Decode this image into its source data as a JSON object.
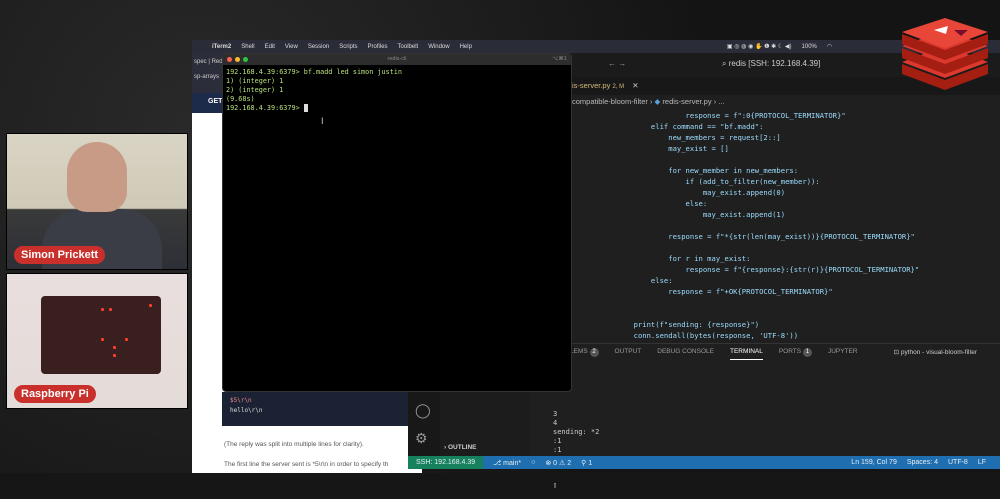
{
  "participants": [
    {
      "name": "Simon Prickett"
    },
    {
      "name": "Raspberry Pi"
    }
  ],
  "menubar": {
    "app": "iTerm2",
    "items": [
      "Shell",
      "Edit",
      "View",
      "Session",
      "Scripts",
      "Profiles",
      "Toolbelt",
      "Window",
      "Help"
    ],
    "battery": "100%"
  },
  "browser": {
    "tab": "spec | Redis",
    "tab2": "sp-arrays",
    "nav": "GET",
    "code_lines": [
      "$5\\r\\n",
      "hello\\r\\n"
    ],
    "para1": "(The reply was split into multiple lines for clarity).",
    "para2": "The first line the server sent is *5\\r\\n in order to specify th"
  },
  "iterm": {
    "title": "redis-cli",
    "shortcut": "⌥⌘1",
    "lines": [
      "192.168.4.39:6379> bf.madd led simon justin",
      "1) (integer) 1",
      "2) (integer) 1",
      "(9.68s)"
    ],
    "prompt": "192.168.4.39:6379> "
  },
  "vscode": {
    "search": "redis [SSH: 192.168.4.39]",
    "tab": {
      "name": "is-server.py",
      "badge": "2, M"
    },
    "breadcrumb": [
      "compatible-bloom-filter",
      "redis-server.py",
      "..."
    ],
    "code": [
      "                    response = f\":0{PROTOCOL_TERMINATOR}\"",
      "            elif command == \"bf.madd\":",
      "                new_members = request[2::]",
      "                may_exist = []",
      "",
      "                for new_member in new_members:",
      "                    if (add_to_filter(new_member)):",
      "                        may_exist.append(0)",
      "                    else:",
      "                        may_exist.append(1)",
      "",
      "                response = f\"*{str(len(may_exist))}{PROTOCOL_TERMINATOR}\"",
      "",
      "                for r in may_exist:",
      "                    response = f\"{response}:{str(r)}{PROTOCOL_TERMINATOR}\"",
      "            else:",
      "                response = f\"+OK{PROTOCOL_TERMINATOR}\"",
      "",
      "",
      "        print(f\"sending: {response}\")",
      "        conn.sendall(bytes(response, 'UTF-8'))"
    ],
    "panel_tabs": [
      {
        "label": "LEMS",
        "badge": "2"
      },
      {
        "label": "OUTPUT"
      },
      {
        "label": "DEBUG CONSOLE"
      },
      {
        "label": "TERMINAL",
        "active": true
      },
      {
        "label": "PORTS",
        "badge": "1"
      },
      {
        "label": "JUPYTER"
      }
    ],
    "terminal_name": "python - visual-bloom-filter",
    "terminal_output": [
      "3",
      "4",
      "sending: *2",
      ":1",
      ":1"
    ],
    "outline": "OUTLINE",
    "status": {
      "ssh": "SSH: 192.168.4.39",
      "branch": "main*",
      "errors": "0",
      "warnings": "2",
      "ports": "1",
      "position": "Ln 159, Col 79",
      "spaces": "Spaces: 4",
      "encoding": "UTF-8",
      "eol": "LF"
    }
  },
  "colors": {
    "redis": "#dc382d",
    "status": "#1f6fb0",
    "ssh": "#16825d",
    "term_green": "#b7e07a"
  }
}
